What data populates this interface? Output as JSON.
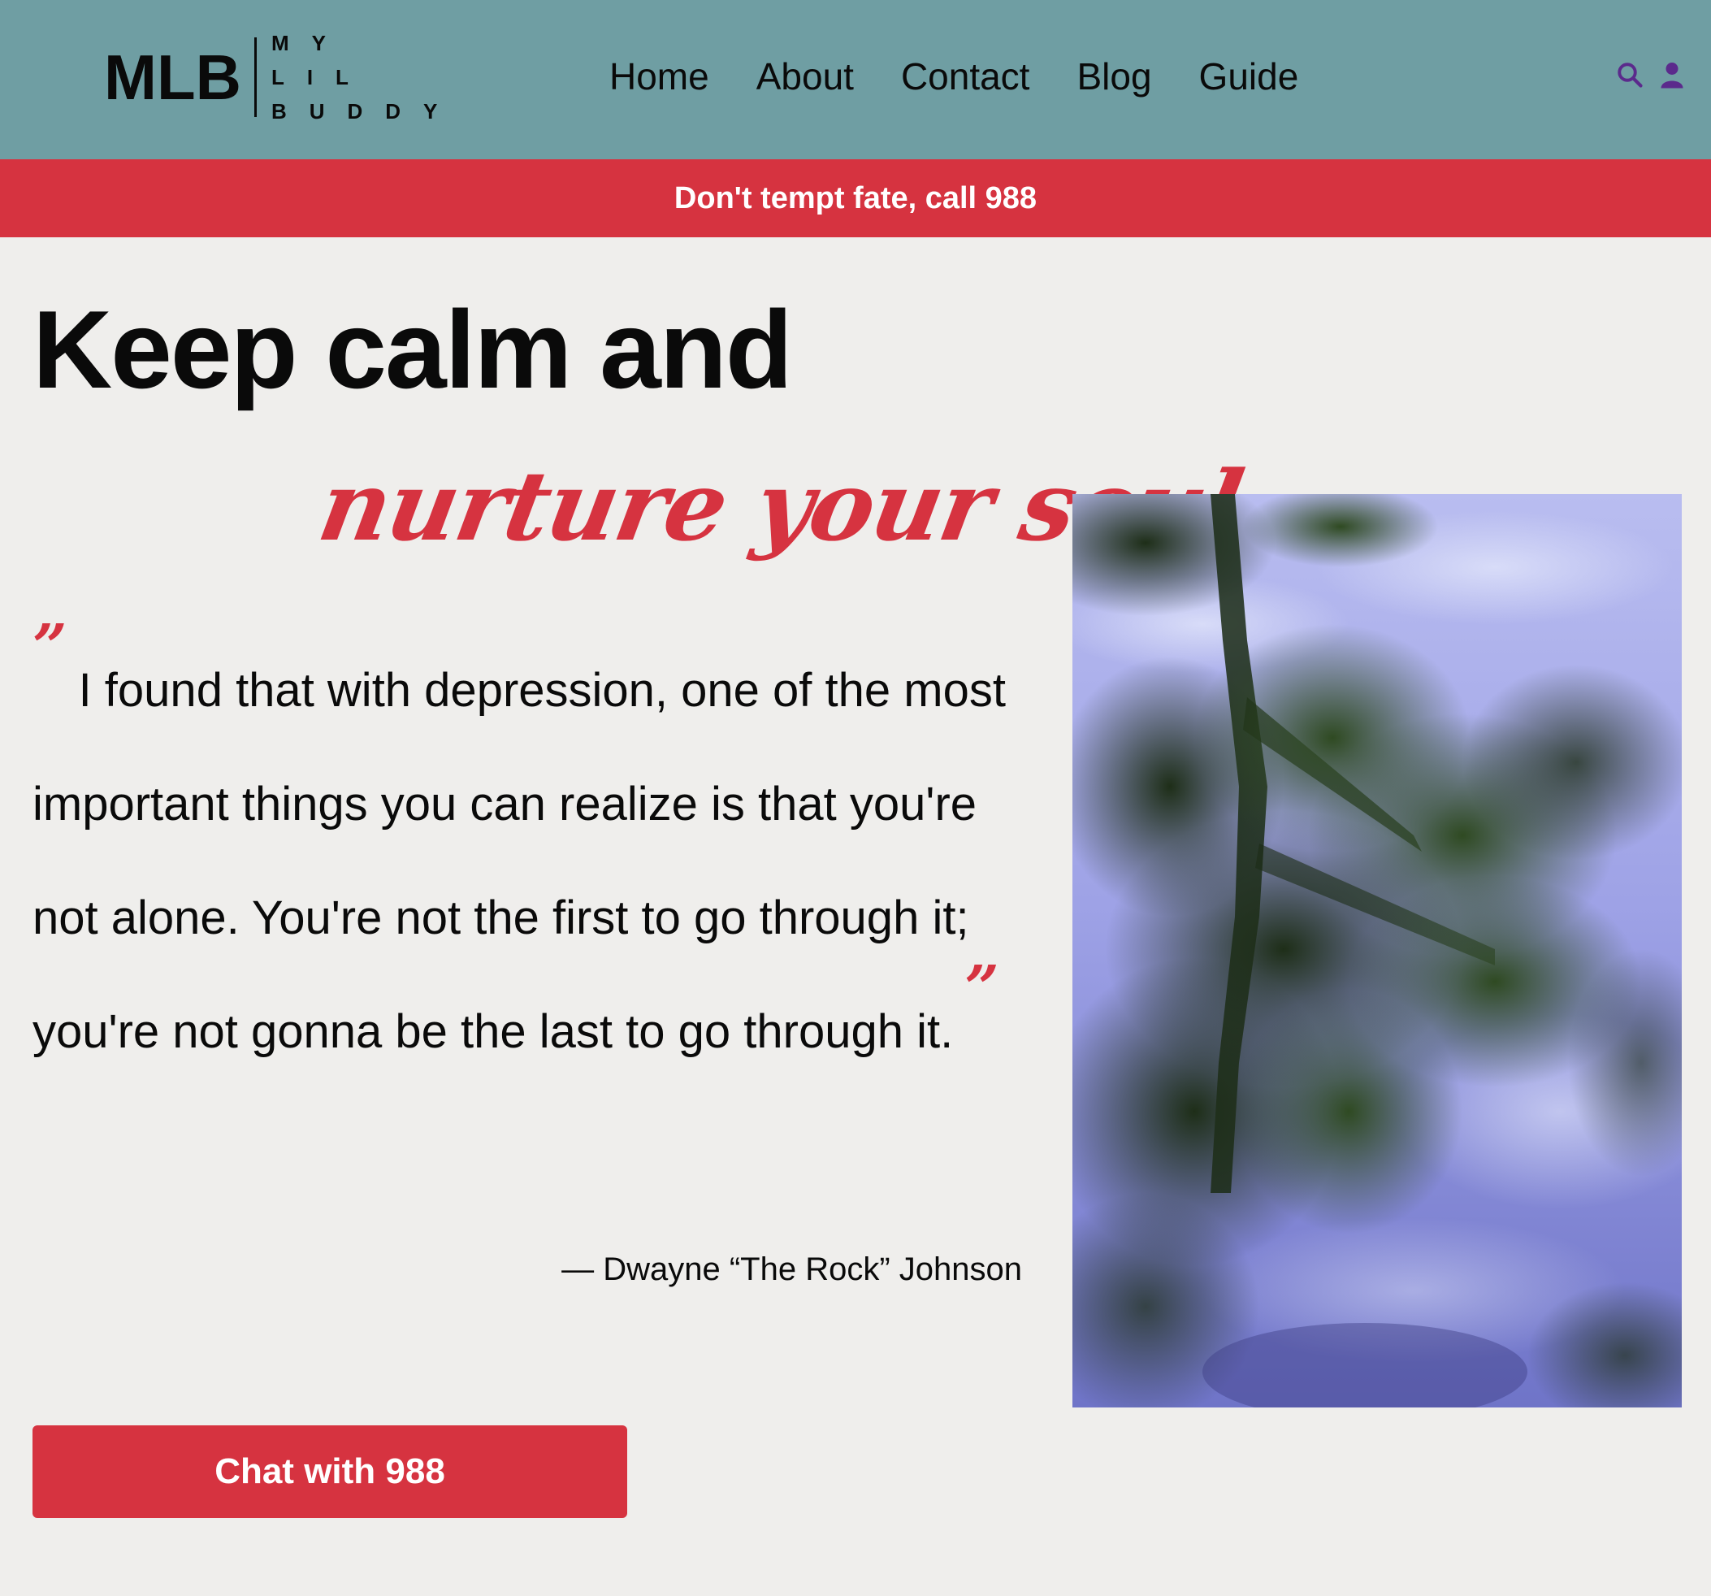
{
  "header": {
    "logo_mark": "MLB",
    "logo_words": [
      "MY",
      "LIL",
      "BUDDY"
    ],
    "nav_items": [
      "Home",
      "About",
      "Contact",
      "Blog",
      "Guide"
    ],
    "icons": [
      "search-icon",
      "user-icon"
    ],
    "icon_color": "#5b2a8c",
    "background_color": "#6f9ea3"
  },
  "alert": {
    "text": "Don't tempt fate, call 988",
    "background_color": "#d63340"
  },
  "hero": {
    "headline": "Keep calm and",
    "subheadline": "nurture your soul",
    "quote_open": "”",
    "quote_text": "I found that with depression, one of the most important things you can realize is that you're not alone. You're not the first to go through it; you're not gonna be the last to go through it.",
    "quote_close": "”",
    "attribution": "— Dwayne “The Rock” Johnson",
    "cta_label": "Chat with 988",
    "accent_color": "#d63340"
  }
}
